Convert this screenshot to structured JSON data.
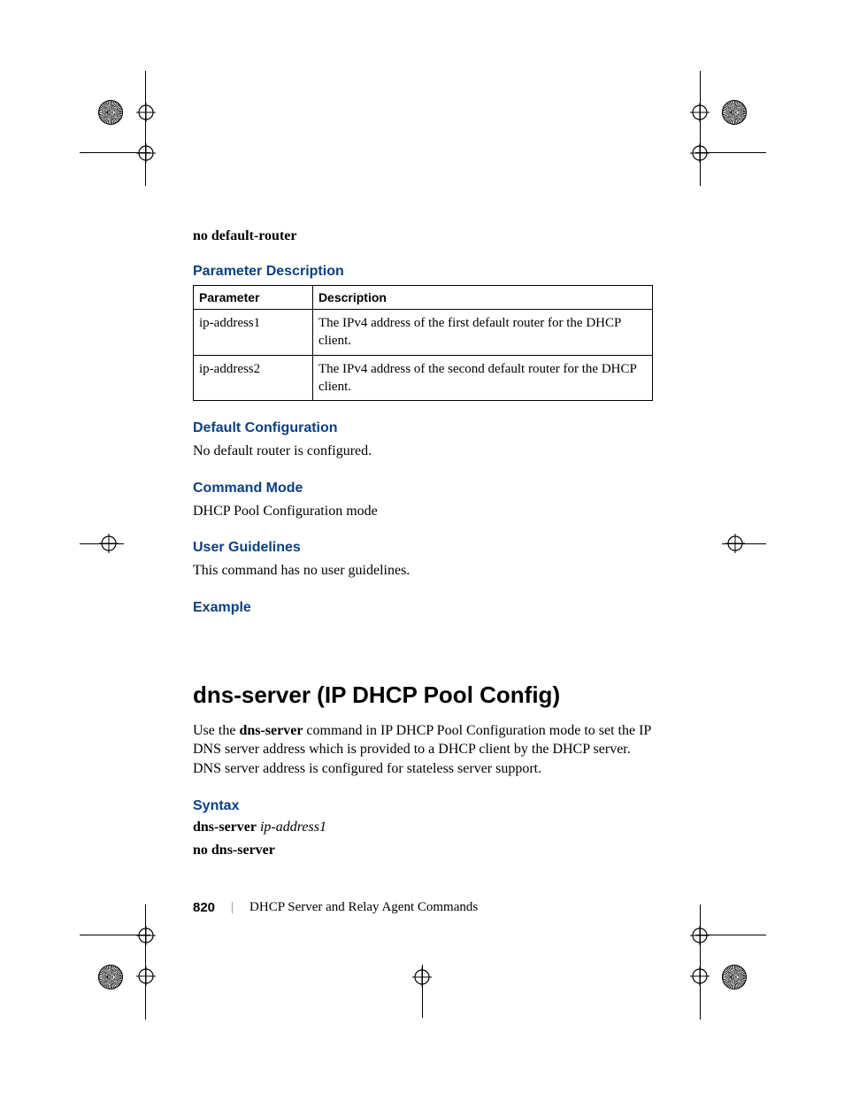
{
  "pre_command": "no default-router",
  "headings": {
    "param_desc": "Parameter Description",
    "default_config": "Default Configuration",
    "command_mode": "Command Mode",
    "user_guidelines": "User Guidelines",
    "example": "Example",
    "syntax": "Syntax"
  },
  "table": {
    "head_param": "Parameter",
    "head_desc": "Description",
    "rows": [
      {
        "param": "ip-address1",
        "desc": "The IPv4 address of the first default router for the DHCP client."
      },
      {
        "param": "ip-address2",
        "desc": "The IPv4 address of the second default router for the DHCP client."
      }
    ]
  },
  "default_config_body": "No default router is configured.",
  "command_mode_body": "DHCP Pool Configuration mode",
  "user_guidelines_body": "This command has no user guidelines.",
  "command_title": "dns-server (IP DHCP Pool Config)",
  "command_intro_pre": "Use the ",
  "command_intro_bold": "dns-server",
  "command_intro_post": " command in IP DHCP Pool Configuration mode to set the IP DNS server address which is provided to a DHCP client by the DHCP server. DNS server address is configured for stateless server support.",
  "syntax": {
    "line1_cmd": "dns-server",
    "line1_arg": "ip-address1",
    "line2": "no dns-server"
  },
  "footer": {
    "page": "820",
    "sep": "|",
    "text": "DHCP Server and Relay Agent Commands"
  }
}
